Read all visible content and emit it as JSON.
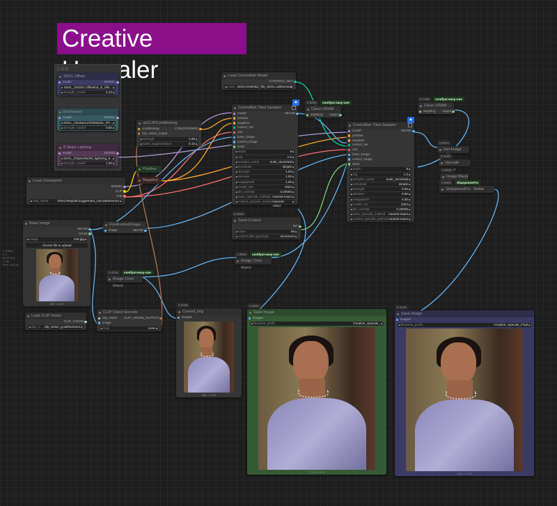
{
  "title": "Creative Upscaler",
  "group_title": "Lora",
  "stats": [
    "T: 0.00s",
    "I: 0",
    "N: 27 [27]",
    "V: 60",
    "FPS: 144.93"
  ],
  "type_colors": {
    "MODEL": "#b39ddb",
    "CLIP": "#ffd500",
    "VAE": "#ff6e6e",
    "CONDITIONING": "#ffa931",
    "IMAGE": "#64b5f6",
    "MASK": "#81c784",
    "CONTROL_NET": "#00d6a0",
    "INT": "#7fd17f",
    "ANY": "#7fd17f",
    "CLIP_VISION": "#a8dadc",
    "CLIP_VISION_OUTPUT": "#ad7452"
  },
  "nodes": [
    {
      "id": "sdxl_offset",
      "title": "SDXL Offset",
      "color": "#2e2e4a",
      "body": "#3b3b66",
      "inputs": [
        {
          "name": "model",
          "type": "MODEL"
        }
      ],
      "outputs": [
        {
          "name": "MODEL",
          "type": "MODEL"
        }
      ],
      "widgets": [
        {
          "label": "",
          "value": "SDXL_2\\SDXL Offsetlod_xl_offs..."
        },
        {
          "label": "strength_model",
          "value": "0.10"
        }
      ]
    },
    {
      "id": "enchancer",
      "title": "Enchancer",
      "color": "#2d4a50",
      "body": "#365a62",
      "inputs": [
        {
          "name": "model",
          "type": "MODEL"
        }
      ],
      "outputs": [
        {
          "name": "MODEL",
          "type": "MODEL"
        }
      ],
      "widgets": [
        {
          "label": "",
          "value": "SDXL_1\\Enhancer\\RMSDXL_Ph..."
        },
        {
          "label": "strength_model",
          "value": "0.50"
        }
      ]
    },
    {
      "id": "lighting",
      "title": "8 Steps Lighting",
      "color": "#3f2a3f",
      "body": "#553a55",
      "inputs": [
        {
          "name": "model",
          "type": "MODEL"
        }
      ],
      "outputs": [
        {
          "name": "MODEL",
          "type": "MODEL"
        }
      ],
      "widgets": [
        {
          "label": "",
          "value": "SDXL_2\\Speedlod\\sl_lightning_8..."
        },
        {
          "label": "strength_model",
          "value": "1.00"
        }
      ]
    },
    {
      "id": "unclip",
      "title": "unCLIPConditioning",
      "inputs": [
        {
          "name": "conditioning",
          "type": "CONDITIONING"
        },
        {
          "name": "clip_vision_output",
          "type": "CLIP_VISION_OUTPUT"
        }
      ],
      "outputs": [
        {
          "name": "CONDITIONING",
          "type": "CONDITIONING"
        }
      ],
      "widgets": [
        {
          "label": "strength",
          "value": "1.00"
        },
        {
          "label": "noise_augmentation",
          "value": "0.10"
        }
      ]
    },
    {
      "id": "positive",
      "title": "Positive",
      "color": "#233823",
      "body": "#2a4a2a",
      "inputs": [],
      "outputs": [],
      "widgets": []
    },
    {
      "id": "negative",
      "title": "Negative",
      "color": "#3a2323",
      "body": "#4a2a2a",
      "inputs": [],
      "outputs": [],
      "widgets": []
    },
    {
      "id": "checkpoint",
      "title": "Load Checkpoint",
      "inputs": [],
      "outputs": [
        {
          "name": "MODEL",
          "type": "MODEL"
        },
        {
          "name": "CLIP",
          "type": "CLIP"
        },
        {
          "name": "VAE",
          "type": "VAE"
        }
      ],
      "widgets": [
        {
          "label": "ckpt_name",
          "value": "SDXL\\Regular\\Juggernaut_v10.safetensors"
        }
      ]
    },
    {
      "id": "controlnet_loader",
      "title": "Load ControlNet Model",
      "inputs": [],
      "outputs": [
        {
          "name": "CONTROL_NET",
          "type": "CONTROL_NET"
        }
      ],
      "widgets": [
        {
          "label": "contr...",
          "value": "SDXL\\CNet\\ttd_Tile_SDXL.safetensors"
        }
      ]
    },
    {
      "id": "tiled1",
      "title": "ControlNet Tiled Sampler",
      "inputs": [
        {
          "name": "model",
          "type": "MODEL"
        },
        {
          "name": "positive",
          "type": "CONDITIONING"
        },
        {
          "name": "negative",
          "type": "CONDITIONING"
        },
        {
          "name": "control_net",
          "type": "CONTROL_NET"
        },
        {
          "name": "vae",
          "type": "VAE"
        },
        {
          "name": "base_image",
          "type": "IMAGE"
        },
        {
          "name": "control_image",
          "type": "IMAGE"
        },
        {
          "name": "seed",
          "type": "INT"
        }
      ],
      "outputs": [
        {
          "name": "IMAGE",
          "type": "IMAGE"
        }
      ],
      "widgets": [
        {
          "label": "steps",
          "value": "8"
        },
        {
          "label": "cfg",
          "value": "1.0"
        },
        {
          "label": "sampler_name",
          "value": "euler_ancestral"
        },
        {
          "label": "scheduler",
          "value": "simple"
        },
        {
          "label": "strength",
          "value": "1.00"
        },
        {
          "label": "denoise",
          "value": "1.00"
        },
        {
          "label": "megapixels",
          "value": "1.00"
        },
        {
          "label": "model_res",
          "value": "1024"
        },
        {
          "label": "tile_overlap",
          "value": "0.20000"
        },
        {
          "label": "base_upscale_method",
          "value": "nearest-exact"
        },
        {
          "label": "control_upscale_method",
          "value": "nearest-exact"
        }
      ]
    },
    {
      "id": "clean1",
      "title": "Clean VRAM ...",
      "timing": "0.885s",
      "badge": "comfyui-easy-use",
      "inputs": [
        {
          "name": "anything",
          "type": "ANY"
        }
      ],
      "outputs": [
        {
          "name": "output",
          "type": "ANY"
        }
      ],
      "widgets": []
    },
    {
      "id": "tiled2",
      "title": "ControlNet Tiled Sampler",
      "inputs": [
        {
          "name": "model",
          "type": "MODEL"
        },
        {
          "name": "positive",
          "type": "CONDITIONING"
        },
        {
          "name": "negative",
          "type": "CONDITIONING"
        },
        {
          "name": "control_net",
          "type": "CONTROL_NET"
        },
        {
          "name": "vae",
          "type": "VAE"
        },
        {
          "name": "base_image",
          "type": "IMAGE"
        },
        {
          "name": "control_image",
          "type": "IMAGE"
        },
        {
          "name": "seed",
          "type": "INT"
        }
      ],
      "outputs": [
        {
          "name": "IMAGE",
          "type": "IMAGE"
        }
      ],
      "widgets": [
        {
          "label": "steps",
          "value": "8"
        },
        {
          "label": "cfg",
          "value": "1.0"
        },
        {
          "label": "sampler_name",
          "value": "euler_ancestral"
        },
        {
          "label": "scheduler",
          "value": "simple"
        },
        {
          "label": "strength",
          "value": "0.50"
        },
        {
          "label": "denoise",
          "value": "0.80"
        },
        {
          "label": "megapixels",
          "value": "4.00"
        },
        {
          "label": "model_res",
          "value": "1024"
        },
        {
          "label": "tile_overlap",
          "value": "0.20000"
        },
        {
          "label": "base_upscale_method",
          "value": "nearest-exact"
        },
        {
          "label": "control_upscale_method",
          "value": "nearest-exact"
        }
      ]
    },
    {
      "id": "clean2",
      "title": "Clean VRAM ...",
      "timing": "0.728s",
      "badge": "comfyui-easy-use",
      "inputs": [
        {
          "name": "anything",
          "type": "ANY"
        }
      ],
      "outputs": [
        {
          "name": "output",
          "type": "ANY"
        }
      ],
      "widgets": []
    },
    {
      "id": "getsize",
      "title": "Get Image Size",
      "timing": "0.037s",
      "inputs": [],
      "outputs": [],
      "widgets": []
    },
    {
      "id": "upscale",
      "title": "Upscale Image",
      "timing": "0.018s",
      "inputs": [],
      "outputs": [],
      "widgets": []
    },
    {
      "id": "blend",
      "title": "Image Blend",
      "timing": "0.033s",
      "inputs": [],
      "outputs": [],
      "widgets": []
    },
    {
      "id": "sharp",
      "title": "SharpnessPro · Nettie",
      "timing": "0.580s",
      "badge": "SharpnessPro",
      "inputs": [],
      "outputs": [],
      "widgets": []
    },
    {
      "id": "base_image",
      "title": "Base Image",
      "inputs": [],
      "outputs": [
        {
          "name": "IMAGE",
          "type": "IMAGE"
        },
        {
          "name": "MASK",
          "type": "MASK"
        }
      ],
      "widgets": [
        {
          "label": "image",
          "value": "345.jpg"
        }
      ],
      "button": "choose file to upload",
      "image": {
        "caption": "852 × 1130"
      }
    },
    {
      "id": "flux",
      "title": "FluxKontextImage...",
      "inputs": [
        {
          "name": "image",
          "type": "IMAGE"
        }
      ],
      "outputs": [
        {
          "name": "IMAGE",
          "type": "IMAGE"
        }
      ],
      "widgets": []
    },
    {
      "id": "colormatch1",
      "title": "Image Color Match",
      "timing": "0.413s",
      "badge": "comfyui-easy-use",
      "inputs": [],
      "outputs": [],
      "widgets": []
    },
    {
      "id": "seed",
      "title": "Seed Control",
      "timing": "0.004s",
      "inputs": [],
      "outputs": [
        {
          "name": "INT",
          "type": "INT"
        }
      ],
      "widgets": [
        {
          "label": "value",
          "value": "69"
        },
        {
          "label": "control after generate",
          "value": "increment"
        }
      ]
    },
    {
      "id": "colormatch2",
      "title": "Image Color Match",
      "timing": "1.666s",
      "badge": "comfyui-easy-use",
      "inputs": [],
      "outputs": [],
      "widgets": []
    },
    {
      "id": "clipvision",
      "title": "Load CLIP Vision",
      "inputs": [],
      "outputs": [
        {
          "name": "CLIP_VISION",
          "type": "CLIP_VISION"
        }
      ],
      "widgets": [
        {
          "label": "clip_n...",
          "value": "clip_vision_g.safetensors"
        }
      ]
    },
    {
      "id": "clipencode",
      "title": "CLIP Vision Encode",
      "inputs": [
        {
          "name": "clip_vision",
          "type": "CLIP_VISION"
        },
        {
          "name": "image",
          "type": "IMAGE"
        }
      ],
      "outputs": [
        {
          "name": "CLIP_VISION_OUTPUT",
          "type": "CLIP_VISION_OUTPUT"
        }
      ],
      "widgets": [
        {
          "label": "crop",
          "value": "none"
        }
      ]
    },
    {
      "id": "control_img",
      "title": "Control_img",
      "timing": "0.043s",
      "inputs": [
        {
          "name": "images",
          "type": "IMAGE"
        }
      ],
      "outputs": [],
      "widgets": [],
      "image": {
        "caption": "852 × 1130"
      }
    },
    {
      "id": "save1",
      "title": "Save Image",
      "timing": "0.402s",
      "color": "#2e4a2e",
      "body": "#355a35",
      "inputs": [
        {
          "name": "images",
          "type": "IMAGE"
        }
      ],
      "outputs": [],
      "widgets": [
        {
          "label": "filename_prefix",
          "value": "Creative_Upscale_"
        }
      ],
      "image": {
        "caption": "1798 × 2376"
      }
    },
    {
      "id": "save2",
      "title": "Save Image",
      "timing": "0.410s",
      "color": "#2e2e4a",
      "body": "#3a3a62",
      "inputs": [
        {
          "name": "images",
          "type": "IMAGE"
        }
      ],
      "outputs": [],
      "widgets": [
        {
          "label": "filename_prefix",
          "value": "Creative_Upscale_Final"
        }
      ],
      "image": {
        "caption": "1798 × 2376"
      }
    }
  ]
}
